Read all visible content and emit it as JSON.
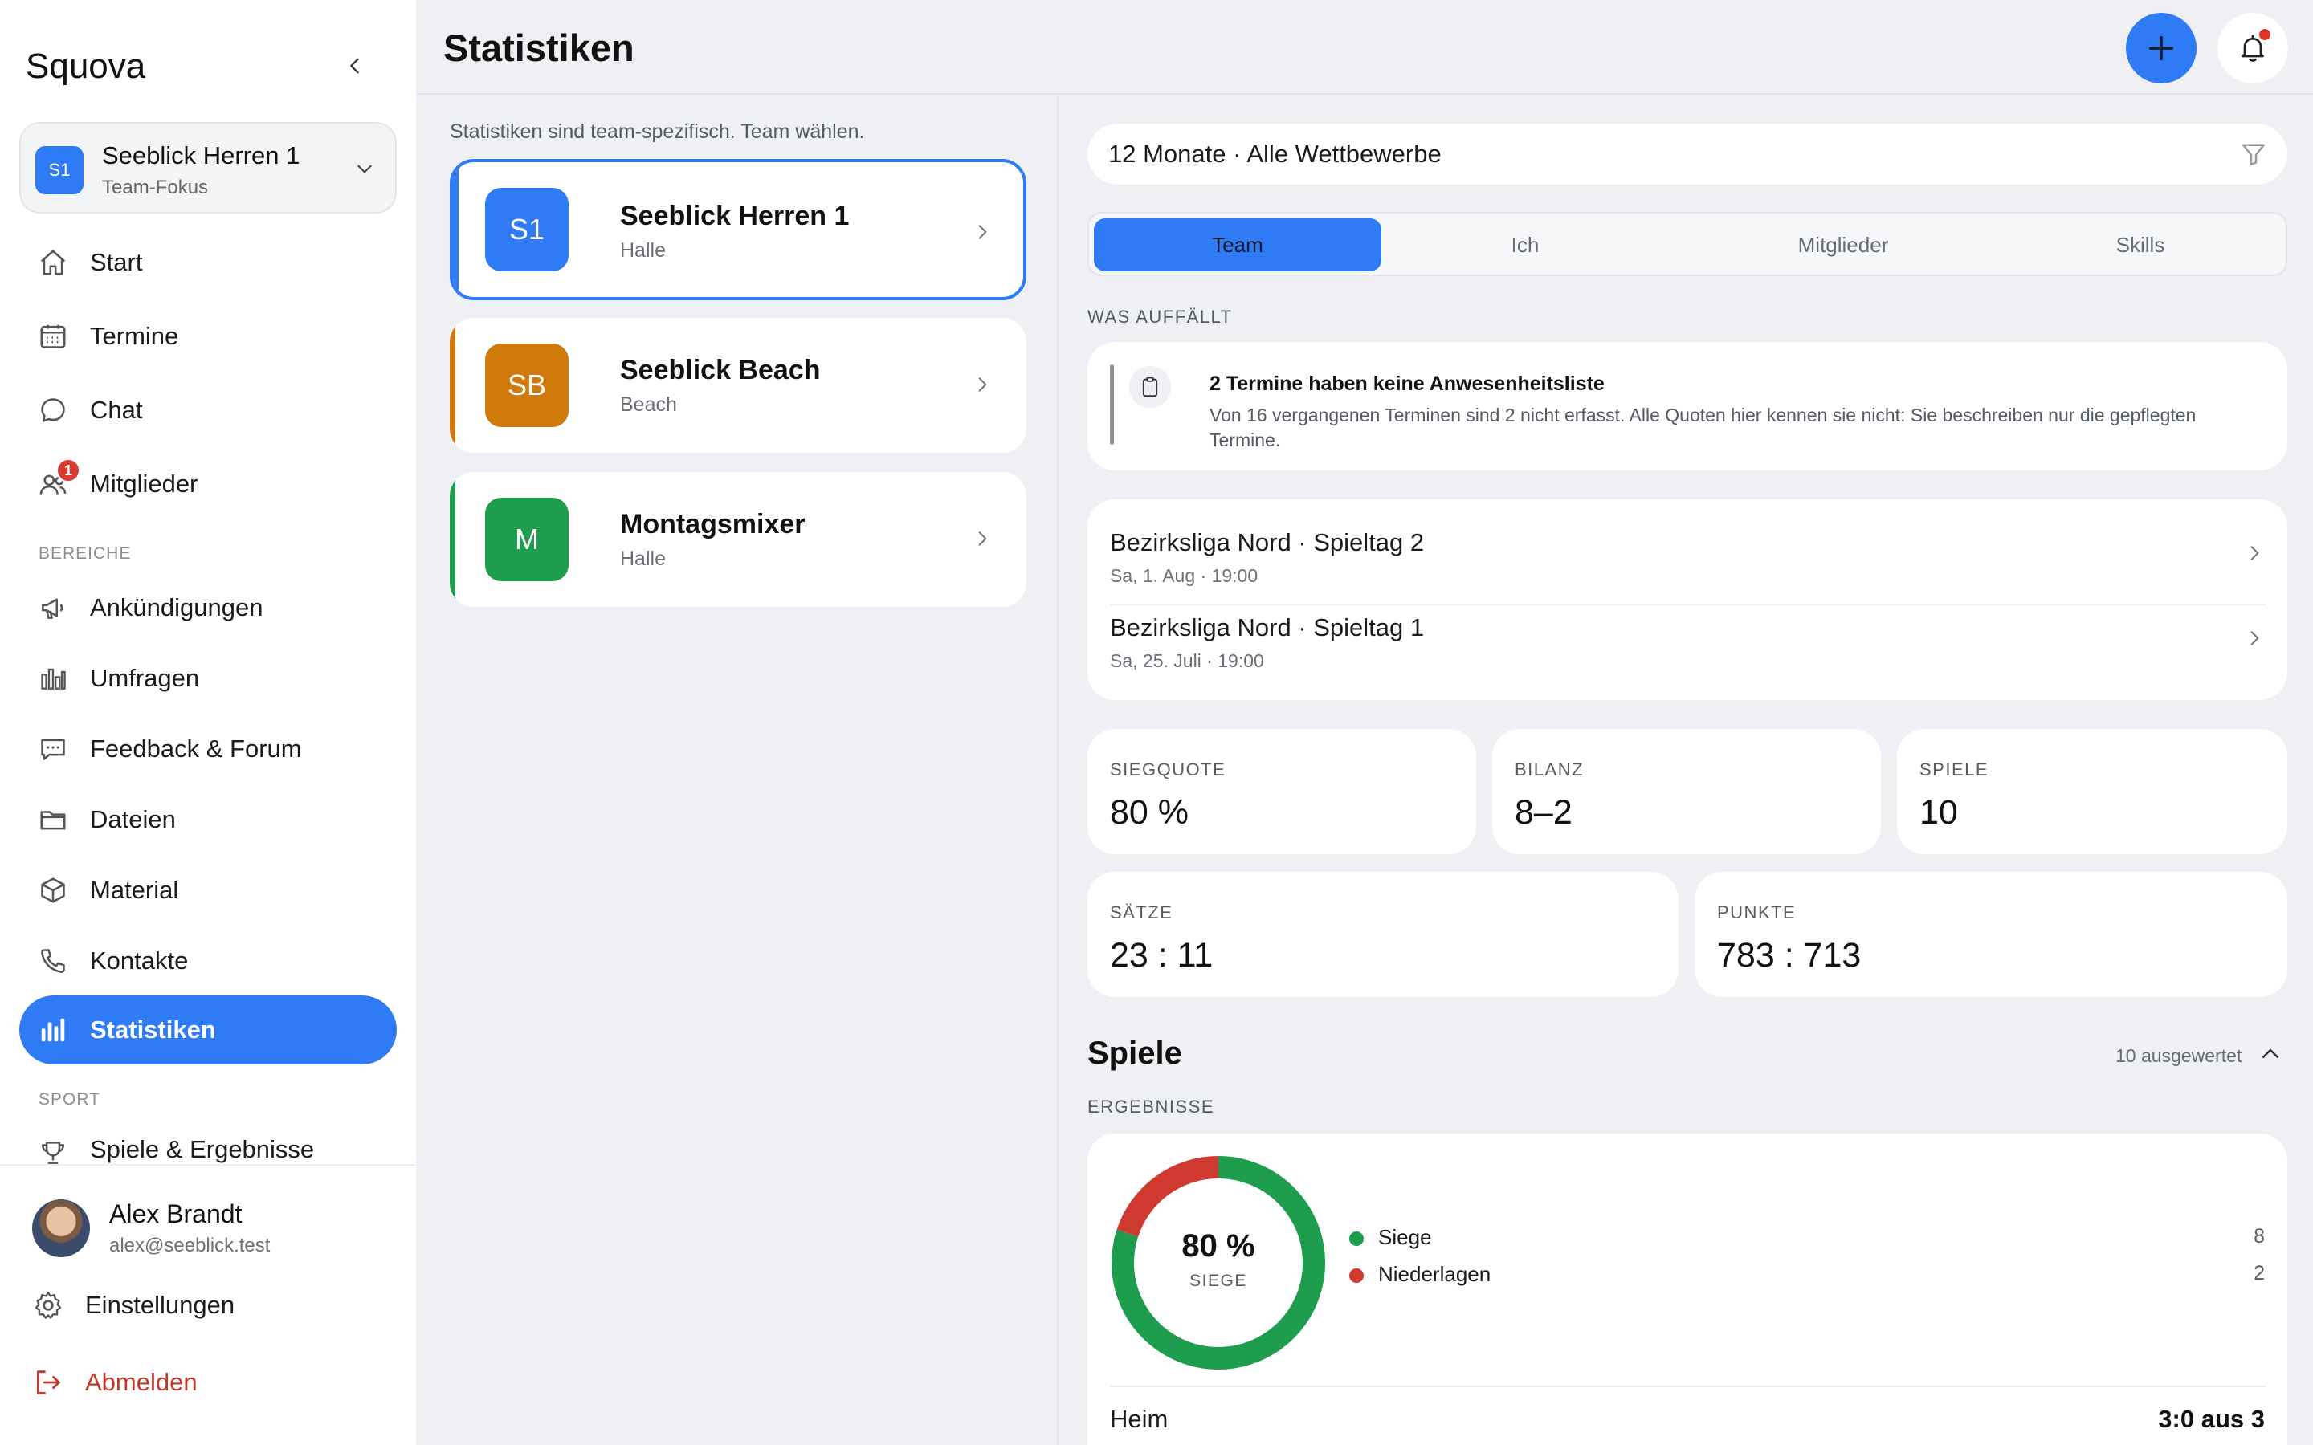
{
  "app": {
    "name": "Squova"
  },
  "team_selector": {
    "initials": "S1",
    "name": "Seeblick Herren 1",
    "subtitle": "Team-Fokus"
  },
  "nav": {
    "main": [
      {
        "label": "Start",
        "icon": "home-icon"
      },
      {
        "label": "Termine",
        "icon": "calendar-icon"
      },
      {
        "label": "Chat",
        "icon": "chat-icon"
      },
      {
        "label": "Mitglieder",
        "icon": "members-icon",
        "badge": "1"
      }
    ],
    "section_bereiche": "BEREICHE",
    "bereiche": [
      {
        "label": "Ankündigungen",
        "icon": "megaphone-icon"
      },
      {
        "label": "Umfragen",
        "icon": "poll-icon"
      },
      {
        "label": "Feedback & Forum",
        "icon": "forum-icon"
      },
      {
        "label": "Dateien",
        "icon": "folder-icon"
      },
      {
        "label": "Material",
        "icon": "box-icon"
      },
      {
        "label": "Kontakte",
        "icon": "phone-icon"
      },
      {
        "label": "Statistiken",
        "icon": "stats-icon",
        "active": true
      }
    ],
    "section_sport": "SPORT",
    "sport": [
      {
        "label": "Spiele & Ergebnisse",
        "icon": "trophy-icon"
      }
    ]
  },
  "user": {
    "name": "Alex Brandt",
    "email": "alex@seeblick.test"
  },
  "footer": {
    "settings": "Einstellungen",
    "logout": "Abmelden"
  },
  "header": {
    "title": "Statistiken"
  },
  "left": {
    "hint": "Statistiken sind team-spezifisch. Team wählen.",
    "teams": [
      {
        "initials": "S1",
        "name": "Seeblick Herren 1",
        "type": "Halle",
        "color": "#2f7bf6"
      },
      {
        "initials": "SB",
        "name": "Seeblick Beach",
        "type": "Beach",
        "color": "#d17a0c"
      },
      {
        "initials": "M",
        "name": "Montagsmixer",
        "type": "Halle",
        "color": "#1f9d4f"
      }
    ]
  },
  "filter": {
    "text": "12 Monate · Alle Wettbewerbe"
  },
  "tabs": [
    "Team",
    "Ich",
    "Mitglieder",
    "Skills"
  ],
  "notice": {
    "caption": "WAS AUFFÄLLT",
    "title": "2 Termine haben keine Anwesenheitsliste",
    "body": "Von 16 vergangenen Terminen sind 2 nicht erfasst. Alle Quoten hier kennen sie nicht: Sie beschreiben nur die gepflegten Termine."
  },
  "games": [
    {
      "title": "Bezirksliga Nord · Spieltag 2",
      "date": "Sa, 1. Aug · 19:00"
    },
    {
      "title": "Bezirksliga Nord · Spieltag 1",
      "date": "Sa, 25. Juli · 19:00"
    }
  ],
  "stats": {
    "siegquote": {
      "label": "SIEGQUOTE",
      "value": "80 %"
    },
    "bilanz": {
      "label": "BILANZ",
      "value": "8–2"
    },
    "spiele": {
      "label": "SPIELE",
      "value": "10"
    },
    "saetze": {
      "label": "SÄTZE",
      "value": "23 : 11"
    },
    "punkte": {
      "label": "PUNKTE",
      "value": "783 : 713"
    }
  },
  "spiele_section": {
    "title": "Spiele",
    "meta": "10 ausgewertet",
    "caption": "ERGEBNISSE",
    "center_value": "80 %",
    "center_label": "SIEGE",
    "home_label": "Heim",
    "home_value": "3:0 aus 3"
  },
  "chart_data": {
    "type": "pie",
    "categories": [
      "Siege",
      "Niederlagen"
    ],
    "values": [
      8,
      2
    ],
    "colors": [
      "#1f9d4f",
      "#d0392f"
    ]
  }
}
